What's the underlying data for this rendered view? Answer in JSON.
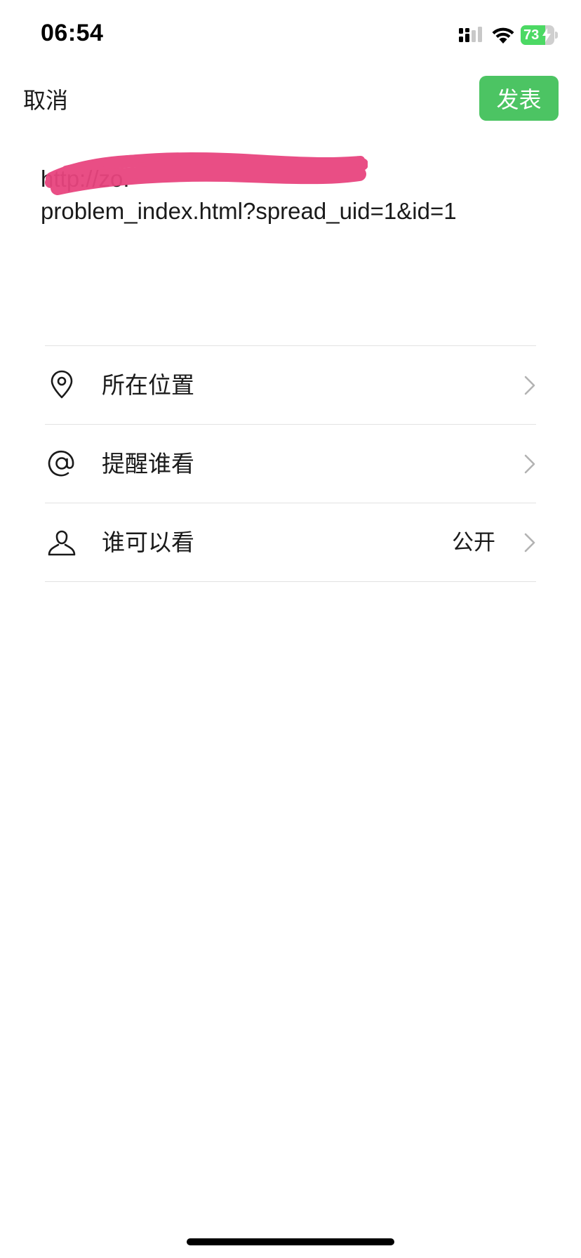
{
  "status_bar": {
    "time": "06:54",
    "battery_level": "73",
    "battery_fraction": 0.73,
    "icons": [
      "signal-icon",
      "wifi-icon",
      "battery-icon",
      "charging-bolt-icon"
    ]
  },
  "nav": {
    "cancel_label": "取消",
    "publish_label": "发表",
    "publish_color": "#4cc463"
  },
  "post": {
    "line1": "http://zo.",
    "line2": "problem_index.html?spread_uid=1&id=1",
    "redaction_color": "#e8457f"
  },
  "options": [
    {
      "icon": "location-pin-icon",
      "label": "所在位置",
      "value": ""
    },
    {
      "icon": "at-sign-icon",
      "label": "提醒谁看",
      "value": ""
    },
    {
      "icon": "person-icon",
      "label": "谁可以看",
      "value": "公开"
    }
  ]
}
